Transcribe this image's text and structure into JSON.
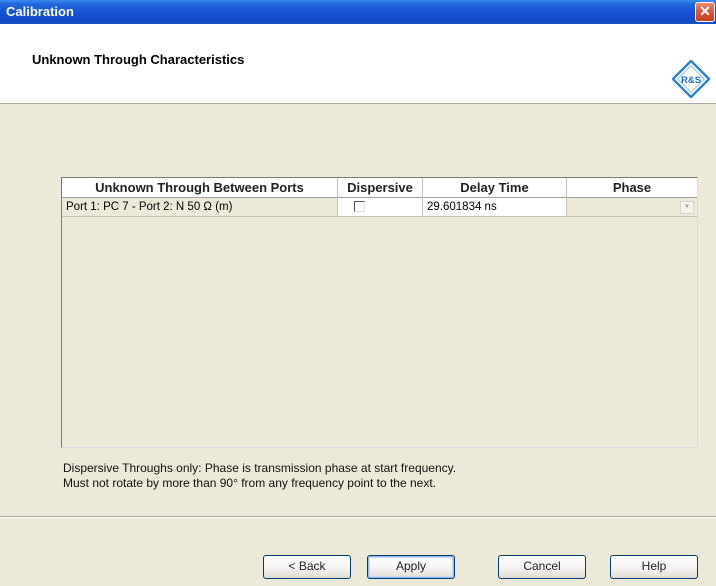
{
  "window": {
    "title": "Calibration",
    "close_glyph": "✕"
  },
  "header": {
    "heading": "Unknown Through Characteristics",
    "logo_text": "R&S"
  },
  "table": {
    "columns": [
      "Unknown Through Between Ports",
      "Dispersive",
      "Delay Time",
      "Phase"
    ],
    "rows": [
      {
        "ports": "Port 1: PC 7 - Port 2: N 50 Ω (m)",
        "dispersive": false,
        "delay_time": "29.601834 ns",
        "phase": ""
      }
    ]
  },
  "notes": {
    "line1": "Dispersive Throughs only: Phase is transmission phase at start frequency.",
    "line2": "Must not rotate by more than 90° from any frequency point to the next."
  },
  "buttons": {
    "back": "< Back",
    "apply": "Apply",
    "cancel": "Cancel",
    "help": "Help"
  }
}
